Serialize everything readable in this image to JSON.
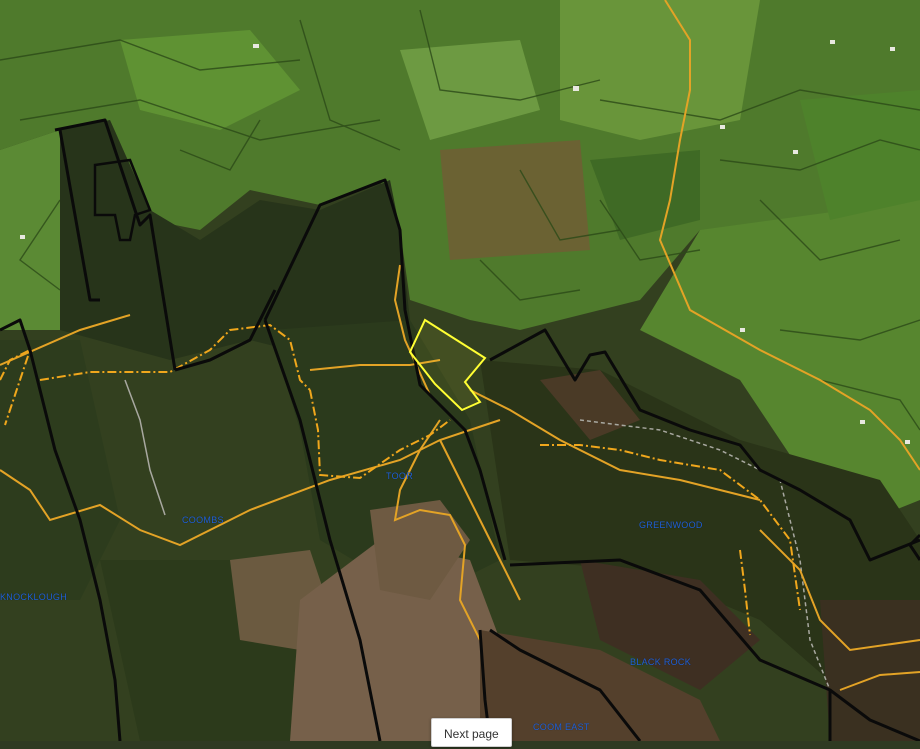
{
  "map": {
    "labels": {
      "coombs": "COOMBS",
      "toor": "TOOR",
      "greenwood": "GREENWOOD",
      "black_rock": "BLACK ROCK",
      "west": "KNOCKLOUGH",
      "bottom": "COOM EAST"
    },
    "colors": {
      "boundary": "#0a0a0a",
      "road": "#e3a326",
      "highlight": "#ffff33",
      "label": "#1f5fd6"
    }
  },
  "controls": {
    "next_page": "Next page"
  }
}
